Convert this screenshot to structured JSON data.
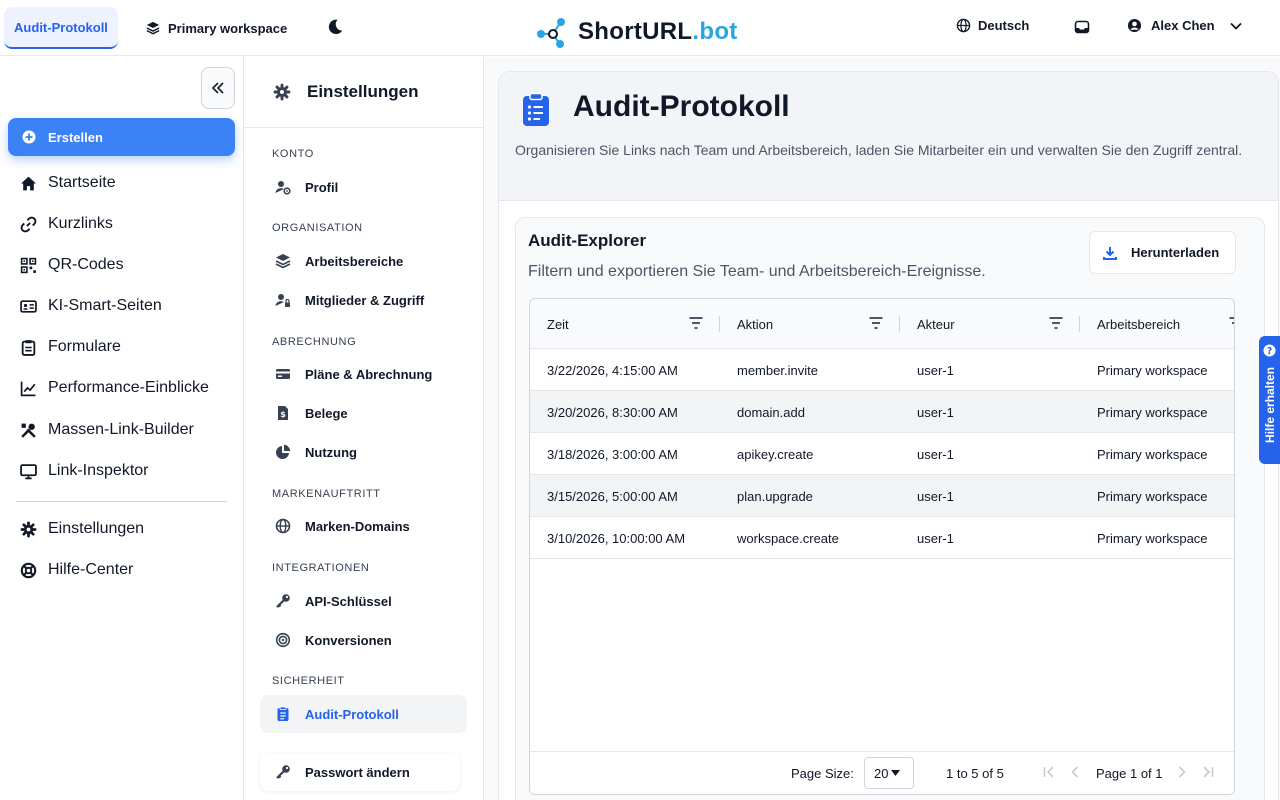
{
  "topbar": {
    "active_tab": "Audit-Protokoll",
    "workspace": "Primary workspace",
    "logo_main": "ShortURL",
    "logo_accent": ".bot",
    "language": "Deutsch",
    "user_name": "Alex Chen"
  },
  "sidebar": {
    "create_label": "Erstellen",
    "items": [
      {
        "label": "Startseite",
        "icon": "home-icon"
      },
      {
        "label": "Kurzlinks",
        "icon": "link-icon"
      },
      {
        "label": "QR-Codes",
        "icon": "qr-code-icon"
      },
      {
        "label": "KI-Smart-Seiten",
        "icon": "id-card-icon"
      },
      {
        "label": "Formulare",
        "icon": "clipboard-icon"
      },
      {
        "label": "Performance-Einblicke",
        "icon": "chart-line-icon"
      },
      {
        "label": "Massen-Link-Builder",
        "icon": "tools-icon"
      },
      {
        "label": "Link-Inspektor",
        "icon": "monitor-icon"
      }
    ],
    "bottom_items": [
      {
        "label": "Einstellungen",
        "icon": "gear-icon"
      },
      {
        "label": "Hilfe-Center",
        "icon": "lifebuoy-icon"
      }
    ]
  },
  "settings": {
    "title": "Einstellungen",
    "sections": {
      "konto": "KONTO",
      "organisation": "ORGANISATION",
      "abrechnung": "ABRECHNUNG",
      "markenauftritt": "MARKENAUFTRITT",
      "integrationen": "INTEGRATIONEN",
      "sicherheit": "SICHERHEIT"
    },
    "items": {
      "profil": "Profil",
      "arbeitsbereiche": "Arbeitsbereiche",
      "mitglieder": "Mitglieder & Zugriff",
      "plaene": "Pläne & Abrechnung",
      "belege": "Belege",
      "nutzung": "Nutzung",
      "marken_domains": "Marken-Domains",
      "api": "API-Schlüssel",
      "konversionen": "Konversionen",
      "audit": "Audit-Protokoll",
      "passwort": "Passwort ändern"
    }
  },
  "main": {
    "title": "Audit-Protokoll",
    "description": "Organisieren Sie Links nach Team und Arbeitsbereich, laden Sie Mitarbeiter ein und verwalten Sie den Zugriff zentral.",
    "explorer_title": "Audit-Explorer",
    "explorer_subtitle": "Filtern und exportieren Sie Team- und Arbeitsbereich-Ereignisse.",
    "download_label": "Herunterladen",
    "columns": [
      "Zeit",
      "Aktion",
      "Akteur",
      "Arbeitsbereich"
    ],
    "rows": [
      [
        "3/22/2026, 4:15:00 AM",
        "member.invite",
        "user-1",
        "Primary workspace"
      ],
      [
        "3/20/2026, 8:30:00 AM",
        "domain.add",
        "user-1",
        "Primary workspace"
      ],
      [
        "3/18/2026, 3:00:00 AM",
        "apikey.create",
        "user-1",
        "Primary workspace"
      ],
      [
        "3/15/2026, 5:00:00 AM",
        "plan.upgrade",
        "user-1",
        "Primary workspace"
      ],
      [
        "3/10/2026, 10:00:00 AM",
        "workspace.create",
        "user-1",
        "Primary workspace"
      ]
    ],
    "pagination": {
      "page_size_label": "Page Size:",
      "page_size": "20",
      "range": "1 to 5 of 5",
      "page": "Page 1 of 1"
    }
  },
  "help_tab": "Hilfe erhalten",
  "colors": {
    "accent": "#3b82f6",
    "accent_dark": "#2563eb",
    "logo_accent": "#2aa5e0"
  }
}
